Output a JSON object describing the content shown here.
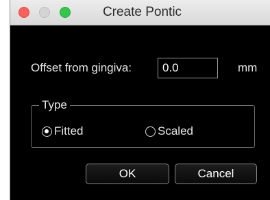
{
  "window": {
    "title": "Create Pontic"
  },
  "offset": {
    "label": "Offset from gingiva:",
    "value": "0.0",
    "unit": "mm"
  },
  "type_group": {
    "legend": "Type",
    "options": [
      {
        "label": "Fitted",
        "selected": true
      },
      {
        "label": "Scaled",
        "selected": false
      }
    ]
  },
  "buttons": {
    "ok": "OK",
    "cancel": "Cancel"
  },
  "colors": {
    "close": "#fc605c",
    "minimize": "#d4d4d4",
    "zoom": "#34c84a",
    "background": "#000000"
  }
}
